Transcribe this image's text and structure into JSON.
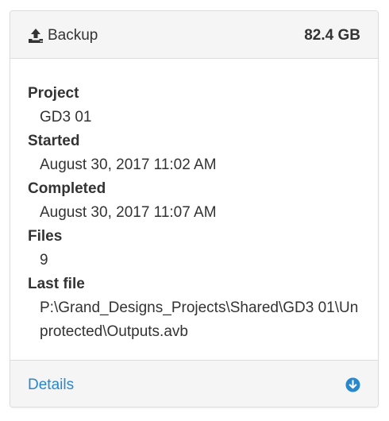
{
  "header": {
    "icon": "upload-icon",
    "title": "Backup",
    "size": "82.4 GB"
  },
  "fields": {
    "project": {
      "label": "Project",
      "value": "GD3 01"
    },
    "started": {
      "label": "Started",
      "value": "August 30, 2017 11:02 AM"
    },
    "completed": {
      "label": "Completed",
      "value": "August 30, 2017 11:07 AM"
    },
    "files": {
      "label": "Files",
      "value": "9"
    },
    "last_file": {
      "label": "Last file",
      "value": "P:\\Grand_Designs_Projects\\Shared\\GD3 01\\Unprotected\\Outputs.avb"
    }
  },
  "footer": {
    "details_label": "Details",
    "expand_icon": "arrow-circle-down-icon"
  },
  "colors": {
    "link": "#2a87c9",
    "panel_bg": "#f5f5f5",
    "border": "#dddddd",
    "text": "#333333"
  }
}
